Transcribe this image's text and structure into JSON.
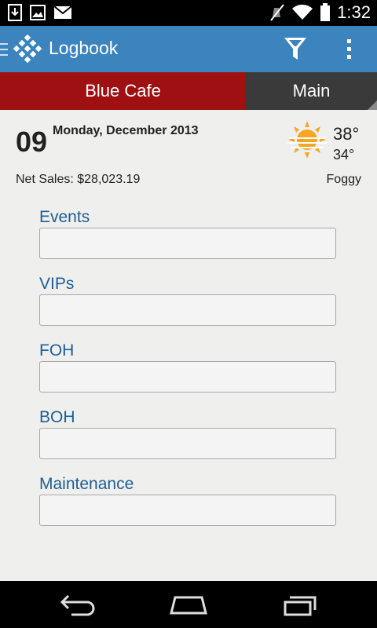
{
  "status_bar": {
    "time": "1:32",
    "icons": [
      "download-icon",
      "image-icon",
      "gmail-icon",
      "mute-icon",
      "wifi-icon",
      "battery-icon"
    ]
  },
  "app_bar": {
    "title": "Logbook",
    "logo_icon": "logbook-logo-icon",
    "filter_icon": "filter-icon",
    "overflow_icon": "overflow-menu-icon",
    "background_color": "#3c84be"
  },
  "tabs": [
    {
      "label": "Blue Cafe",
      "active": true,
      "color": "#9e1011"
    },
    {
      "label": "Main",
      "active": false,
      "color": "#3a3a3a"
    }
  ],
  "day": {
    "day_number": "09",
    "date_label": "Monday, December 2013",
    "temp_high": "38°",
    "temp_low": "34°",
    "weather_icon": "foggy-sun-icon",
    "net_sales": "Net Sales: $28,023.19",
    "condition": "Foggy"
  },
  "fields": [
    {
      "label": "Events",
      "value": ""
    },
    {
      "label": "VIPs",
      "value": ""
    },
    {
      "label": "FOH",
      "value": ""
    },
    {
      "label": "BOH",
      "value": ""
    },
    {
      "label": "Maintenance",
      "value": ""
    }
  ],
  "nav_bar": {
    "icons": [
      "back-icon",
      "home-icon",
      "recent-apps-icon"
    ]
  }
}
